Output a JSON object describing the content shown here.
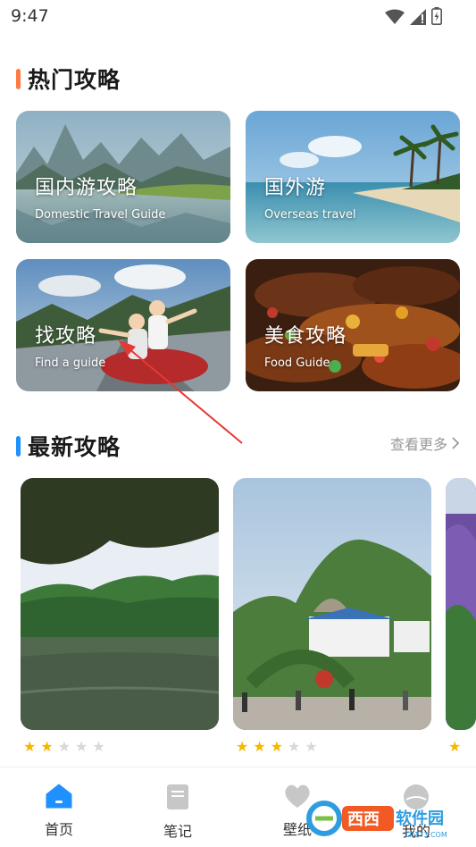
{
  "status": {
    "time": "9:47"
  },
  "hot": {
    "title": "热门攻略",
    "accent": "#ff7a45",
    "cards": [
      {
        "title": "国内游攻略",
        "subtitle": "Domestic Travel Guide"
      },
      {
        "title": "国外游",
        "subtitle": "Overseas travel"
      },
      {
        "title": "找攻略",
        "subtitle": "Find a guide"
      },
      {
        "title": "美食攻略",
        "subtitle": "Food Guide"
      }
    ]
  },
  "latest": {
    "title": "最新攻略",
    "accent": "#1e90ff",
    "see_more": "查看更多",
    "items": [
      {
        "rating": 2,
        "max": 5
      },
      {
        "rating": 3,
        "max": 5
      },
      {
        "rating": 1,
        "max": 5
      }
    ]
  },
  "tabbar": {
    "items": [
      {
        "label": "首页",
        "icon": "home-icon",
        "active": true
      },
      {
        "label": "笔记",
        "icon": "notebook-icon",
        "active": false
      },
      {
        "label": "壁纸",
        "icon": "heart-icon",
        "active": false
      },
      {
        "label": "我的",
        "icon": "user-icon",
        "active": false
      }
    ]
  },
  "watermark": {
    "brand": "西西软件园",
    "url": "CR173.COM"
  },
  "colors": {
    "active": "#1e90ff",
    "inactive": "#b5b5b5",
    "star_on": "#f5b800",
    "star_off": "#d8d8d8"
  }
}
